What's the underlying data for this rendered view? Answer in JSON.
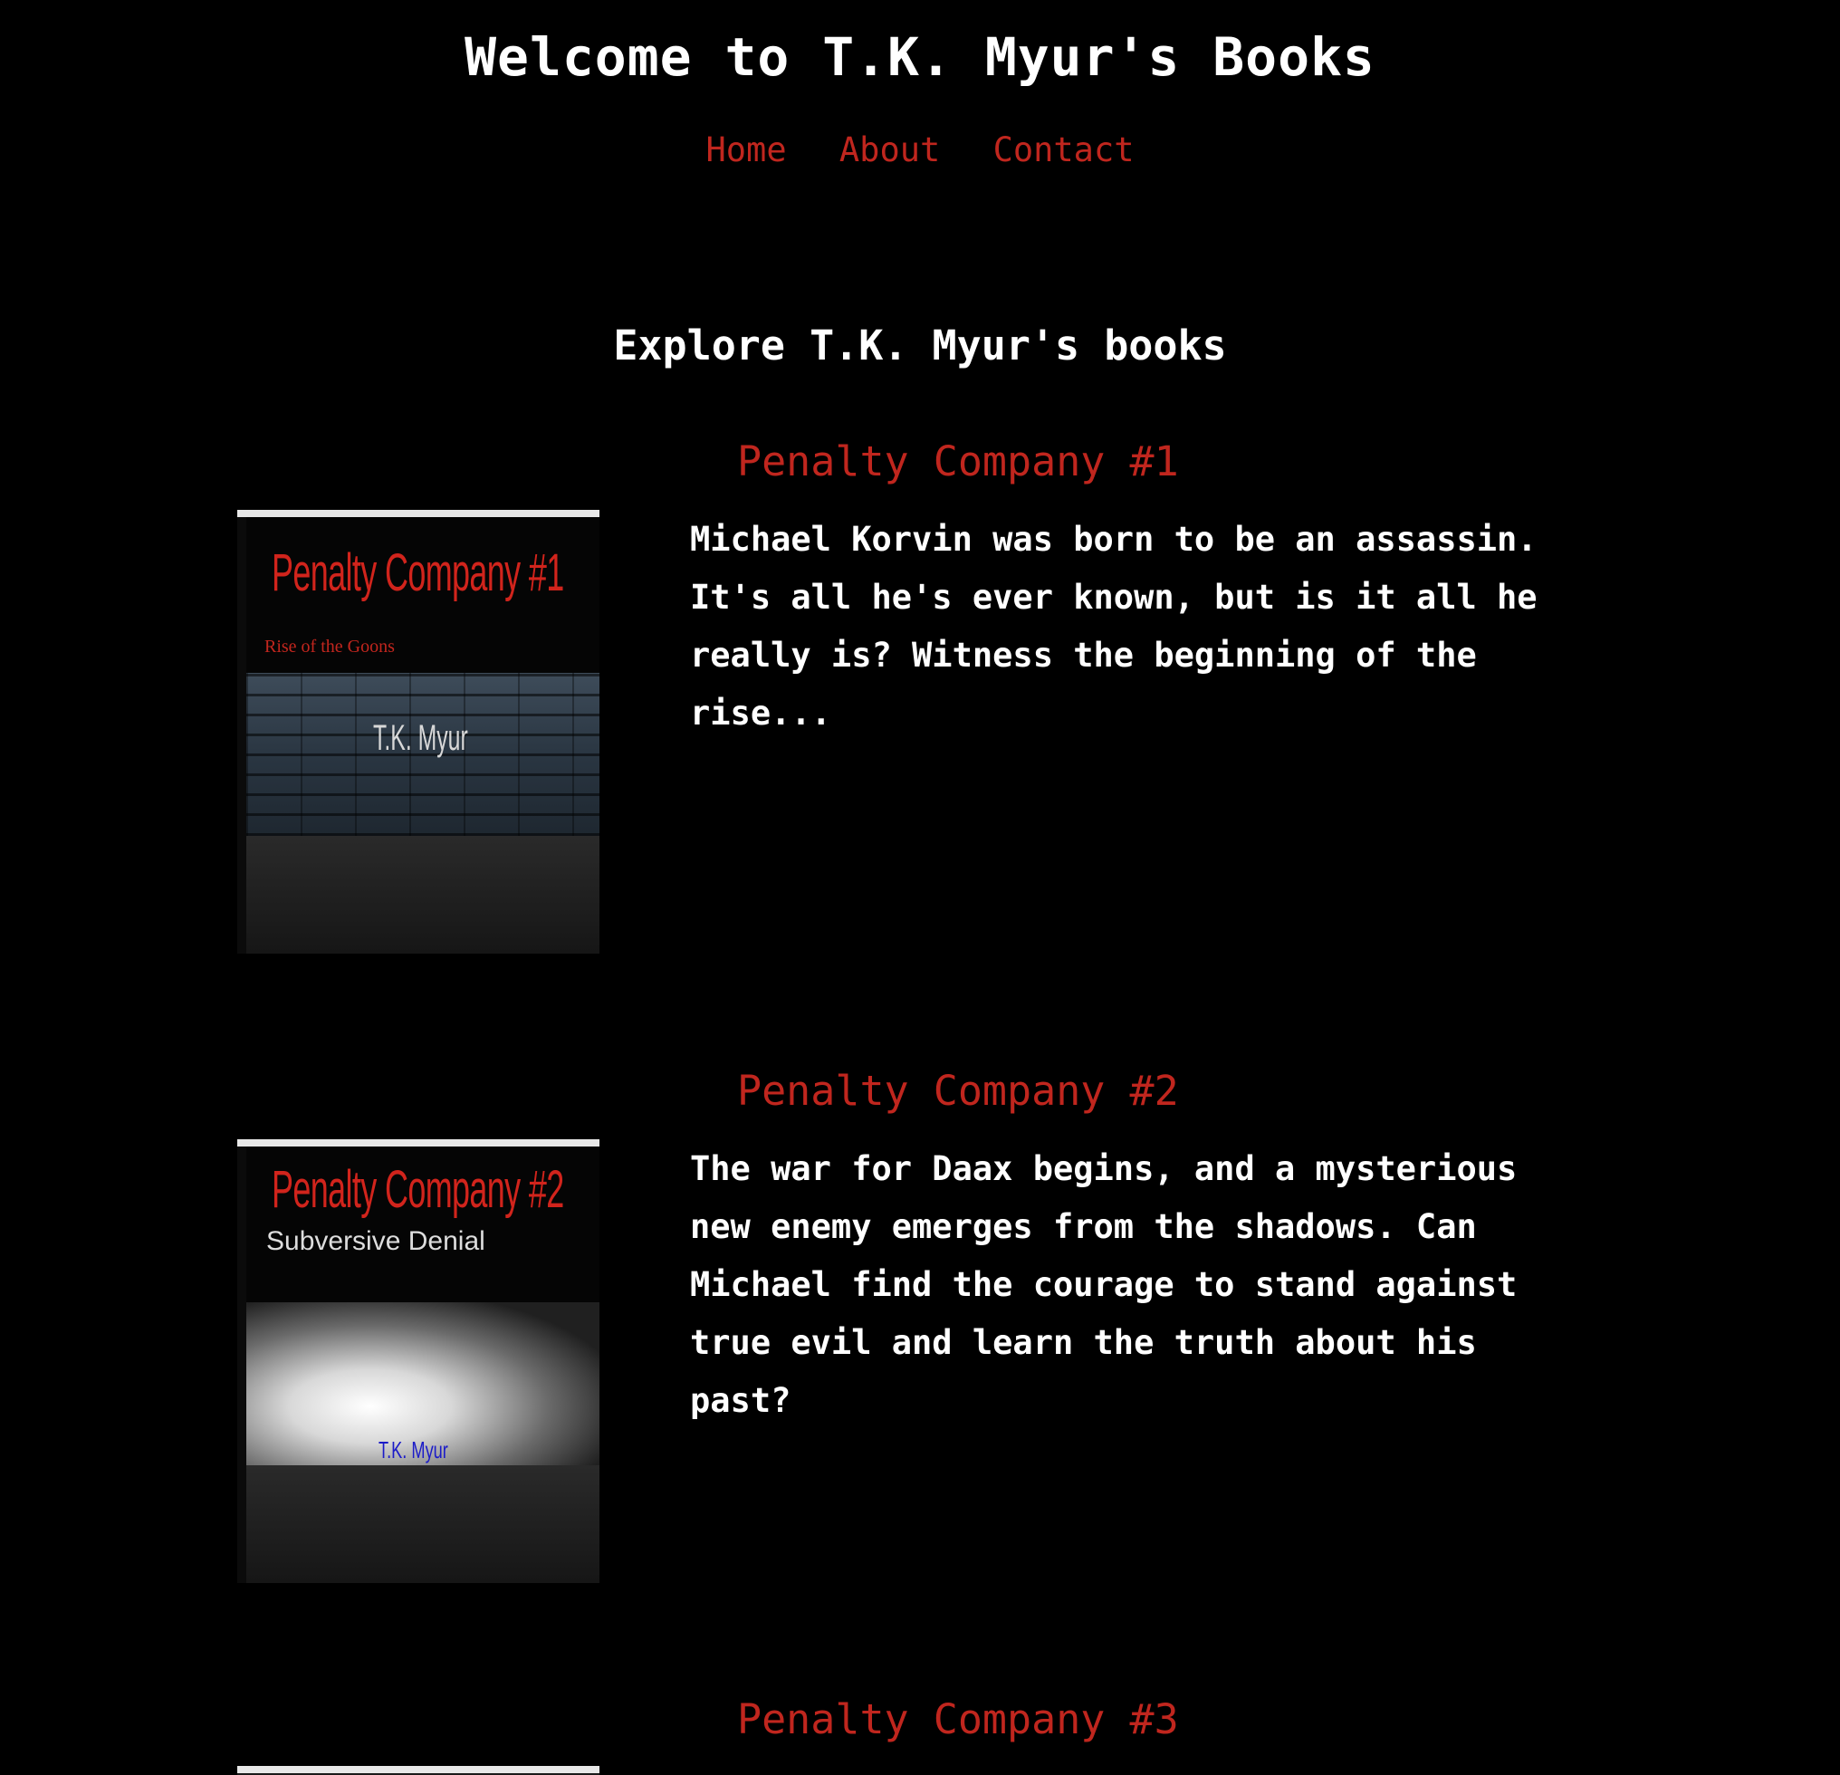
{
  "site": {
    "title": "Welcome to T.K. Myur's Books"
  },
  "nav": {
    "items": [
      "Home",
      "About",
      "Contact"
    ]
  },
  "books_section": {
    "heading": "Explore T.K. Myur's books"
  },
  "books": [
    {
      "title": "Penalty Company #1",
      "description": "Michael Korvin was born to be an assassin. It's all he's ever known, but is it all he really is? Witness the beginning of the rise...",
      "cover": {
        "title": "Penalty Company #1",
        "subtitle": "Rise of the Goons",
        "author": "T.K. Myur"
      }
    },
    {
      "title": "Penalty Company #2",
      "description": "The war for Daax begins, and a mysterious new enemy emerges from the shadows. Can Michael find the courage to stand against true evil and learn the truth about his past?",
      "cover": {
        "title": "Penalty Company #2",
        "subtitle": "Subversive Denial",
        "author": "T.K. Myur"
      }
    },
    {
      "title": "Penalty Company #3"
    }
  ],
  "colors": {
    "background": "#000000",
    "accent_red": "#c0261e",
    "text": "#ffffff"
  }
}
